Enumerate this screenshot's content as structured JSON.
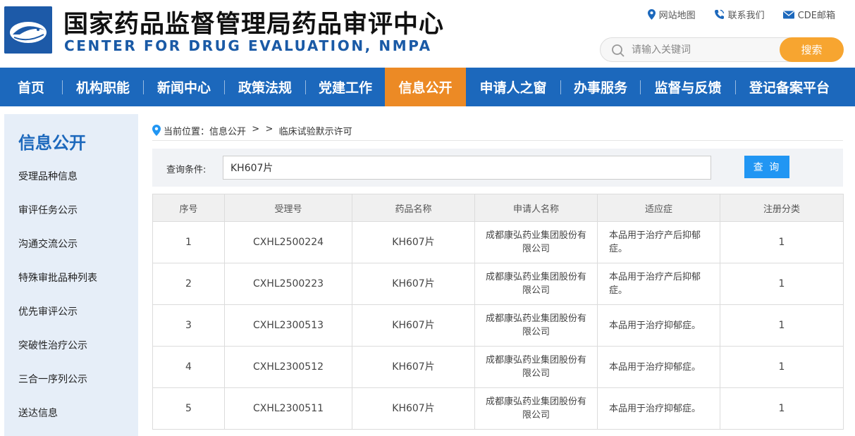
{
  "header": {
    "title_cn": "国家药品监督管理局药品审评中心",
    "title_en": "CENTER FOR DRUG EVALUATION, NMPA",
    "links": {
      "sitemap": "网站地图",
      "contact": "联系我们",
      "mail": "CDE邮箱"
    },
    "search": {
      "placeholder": "请输入关键词",
      "button": "搜索"
    }
  },
  "nav": {
    "items": [
      "首页",
      "机构职能",
      "新闻中心",
      "政策法规",
      "党建工作",
      "信息公开",
      "申请人之窗",
      "办事服务",
      "监督与反馈",
      "登记备案平台"
    ],
    "active": "信息公开"
  },
  "sidebar": {
    "title": "信息公开",
    "items": [
      "受理品种信息",
      "审评任务公示",
      "沟通交流公示",
      "特殊审批品种列表",
      "优先审评公示",
      "突破性治疗公示",
      "三合一序列公示",
      "送达信息"
    ]
  },
  "breadcrumb": {
    "prefix": "当前位置：",
    "section": "信息公开",
    "sep": "  >  >  ",
    "current": "临床试验默示许可"
  },
  "query": {
    "label": "查询条件:",
    "value": "KH607片",
    "button": "查 询"
  },
  "table": {
    "columns": [
      "序号",
      "受理号",
      "药品名称",
      "申请人名称",
      "适应症",
      "注册分类"
    ],
    "rows": [
      {
        "no": "1",
        "acceptance": "CXHL2500224",
        "drug": "KH607片",
        "applicant": "成都康弘药业集团股份有限公司",
        "indication": "本品用于治疗产后抑郁症。",
        "category": "1"
      },
      {
        "no": "2",
        "acceptance": "CXHL2500223",
        "drug": "KH607片",
        "applicant": "成都康弘药业集团股份有限公司",
        "indication": "本品用于治疗产后抑郁症。",
        "category": "1"
      },
      {
        "no": "3",
        "acceptance": "CXHL2300513",
        "drug": "KH607片",
        "applicant": "成都康弘药业集团股份有限公司",
        "indication": "本品用于治疗抑郁症。",
        "category": "1"
      },
      {
        "no": "4",
        "acceptance": "CXHL2300512",
        "drug": "KH607片",
        "applicant": "成都康弘药业集团股份有限公司",
        "indication": "本品用于治疗抑郁症。",
        "category": "1"
      },
      {
        "no": "5",
        "acceptance": "CXHL2300511",
        "drug": "KH607片",
        "applicant": "成都康弘药业集团股份有限公司",
        "indication": "本品用于治疗抑郁症。",
        "category": "1"
      }
    ]
  },
  "colors": {
    "nav_bg": "#1c68bc",
    "nav_active": "#ec8a25",
    "search_button": "#f7a530",
    "query_button": "#2196f3",
    "sidebar_bg": "#e6eef8"
  }
}
